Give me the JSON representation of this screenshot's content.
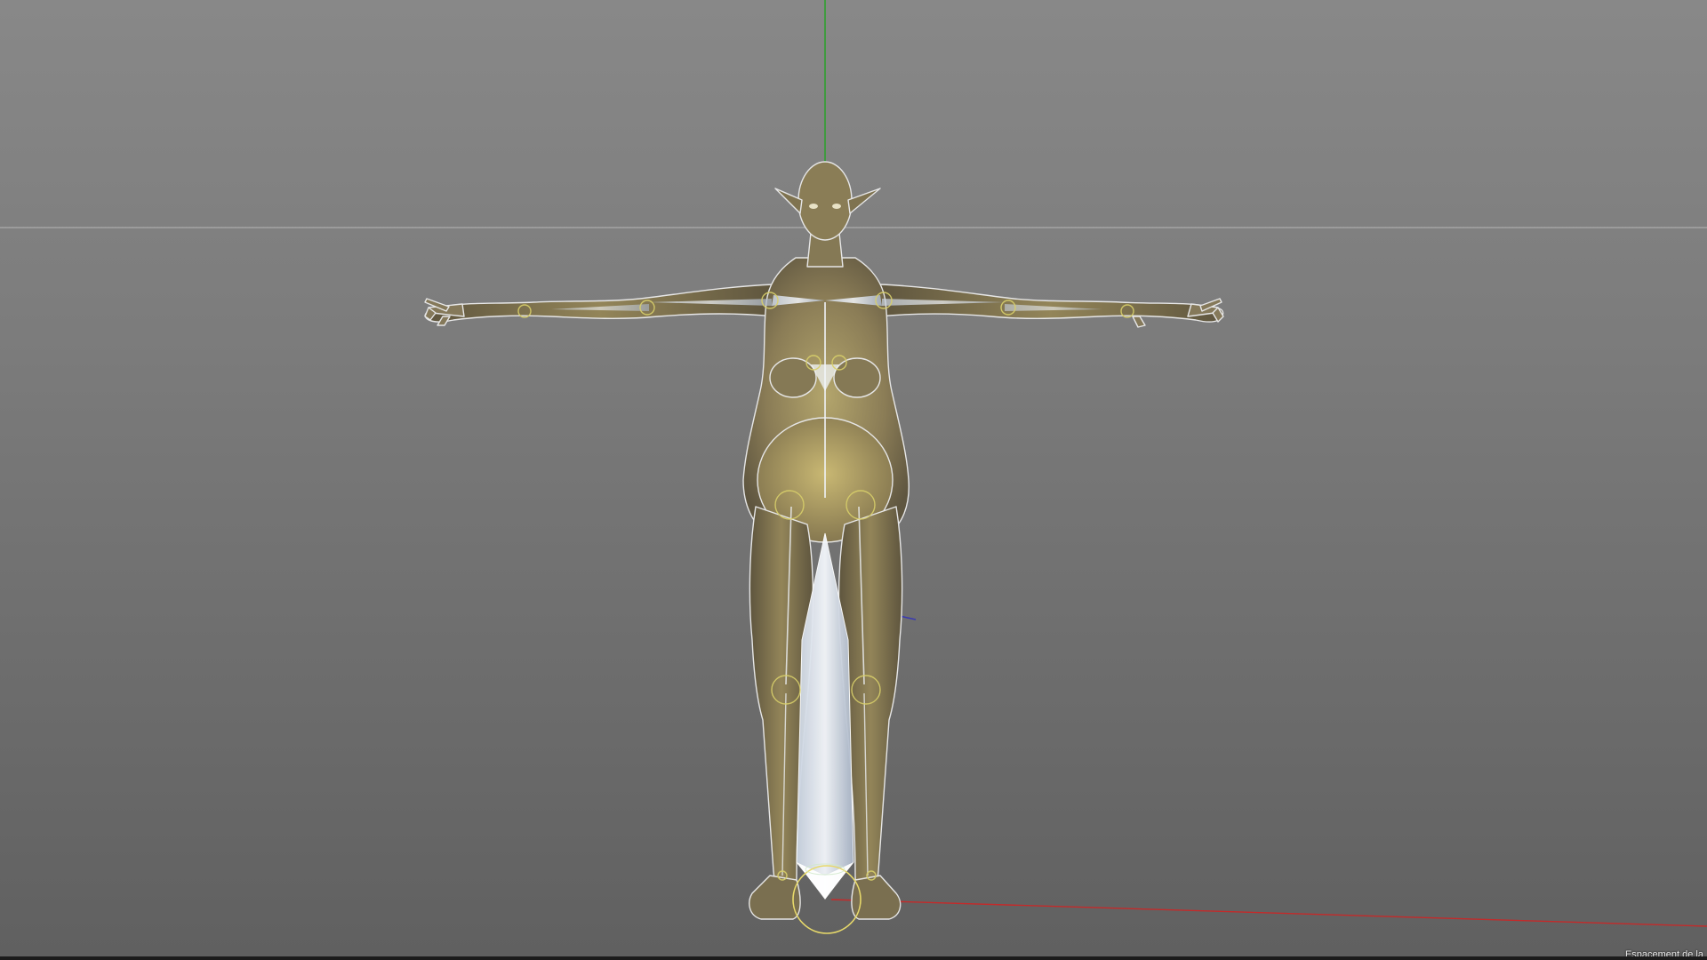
{
  "app": {
    "type": "3d-viewport",
    "background_top": "#888888",
    "background_bottom": "#606060"
  },
  "viewport": {
    "axis_colors": {
      "x_axis": "#c42a2a",
      "y_axis": "#2fa02f",
      "z_axis": "#3a3ab0",
      "horizon": "#b4b4b4"
    },
    "model": {
      "skin_color": "#8c7e58",
      "selection_outline": "#e6e6e6",
      "joint_color": "#d8cf6a",
      "bone_color": "#eef2f8"
    },
    "hud_label": "Espacement de la"
  }
}
